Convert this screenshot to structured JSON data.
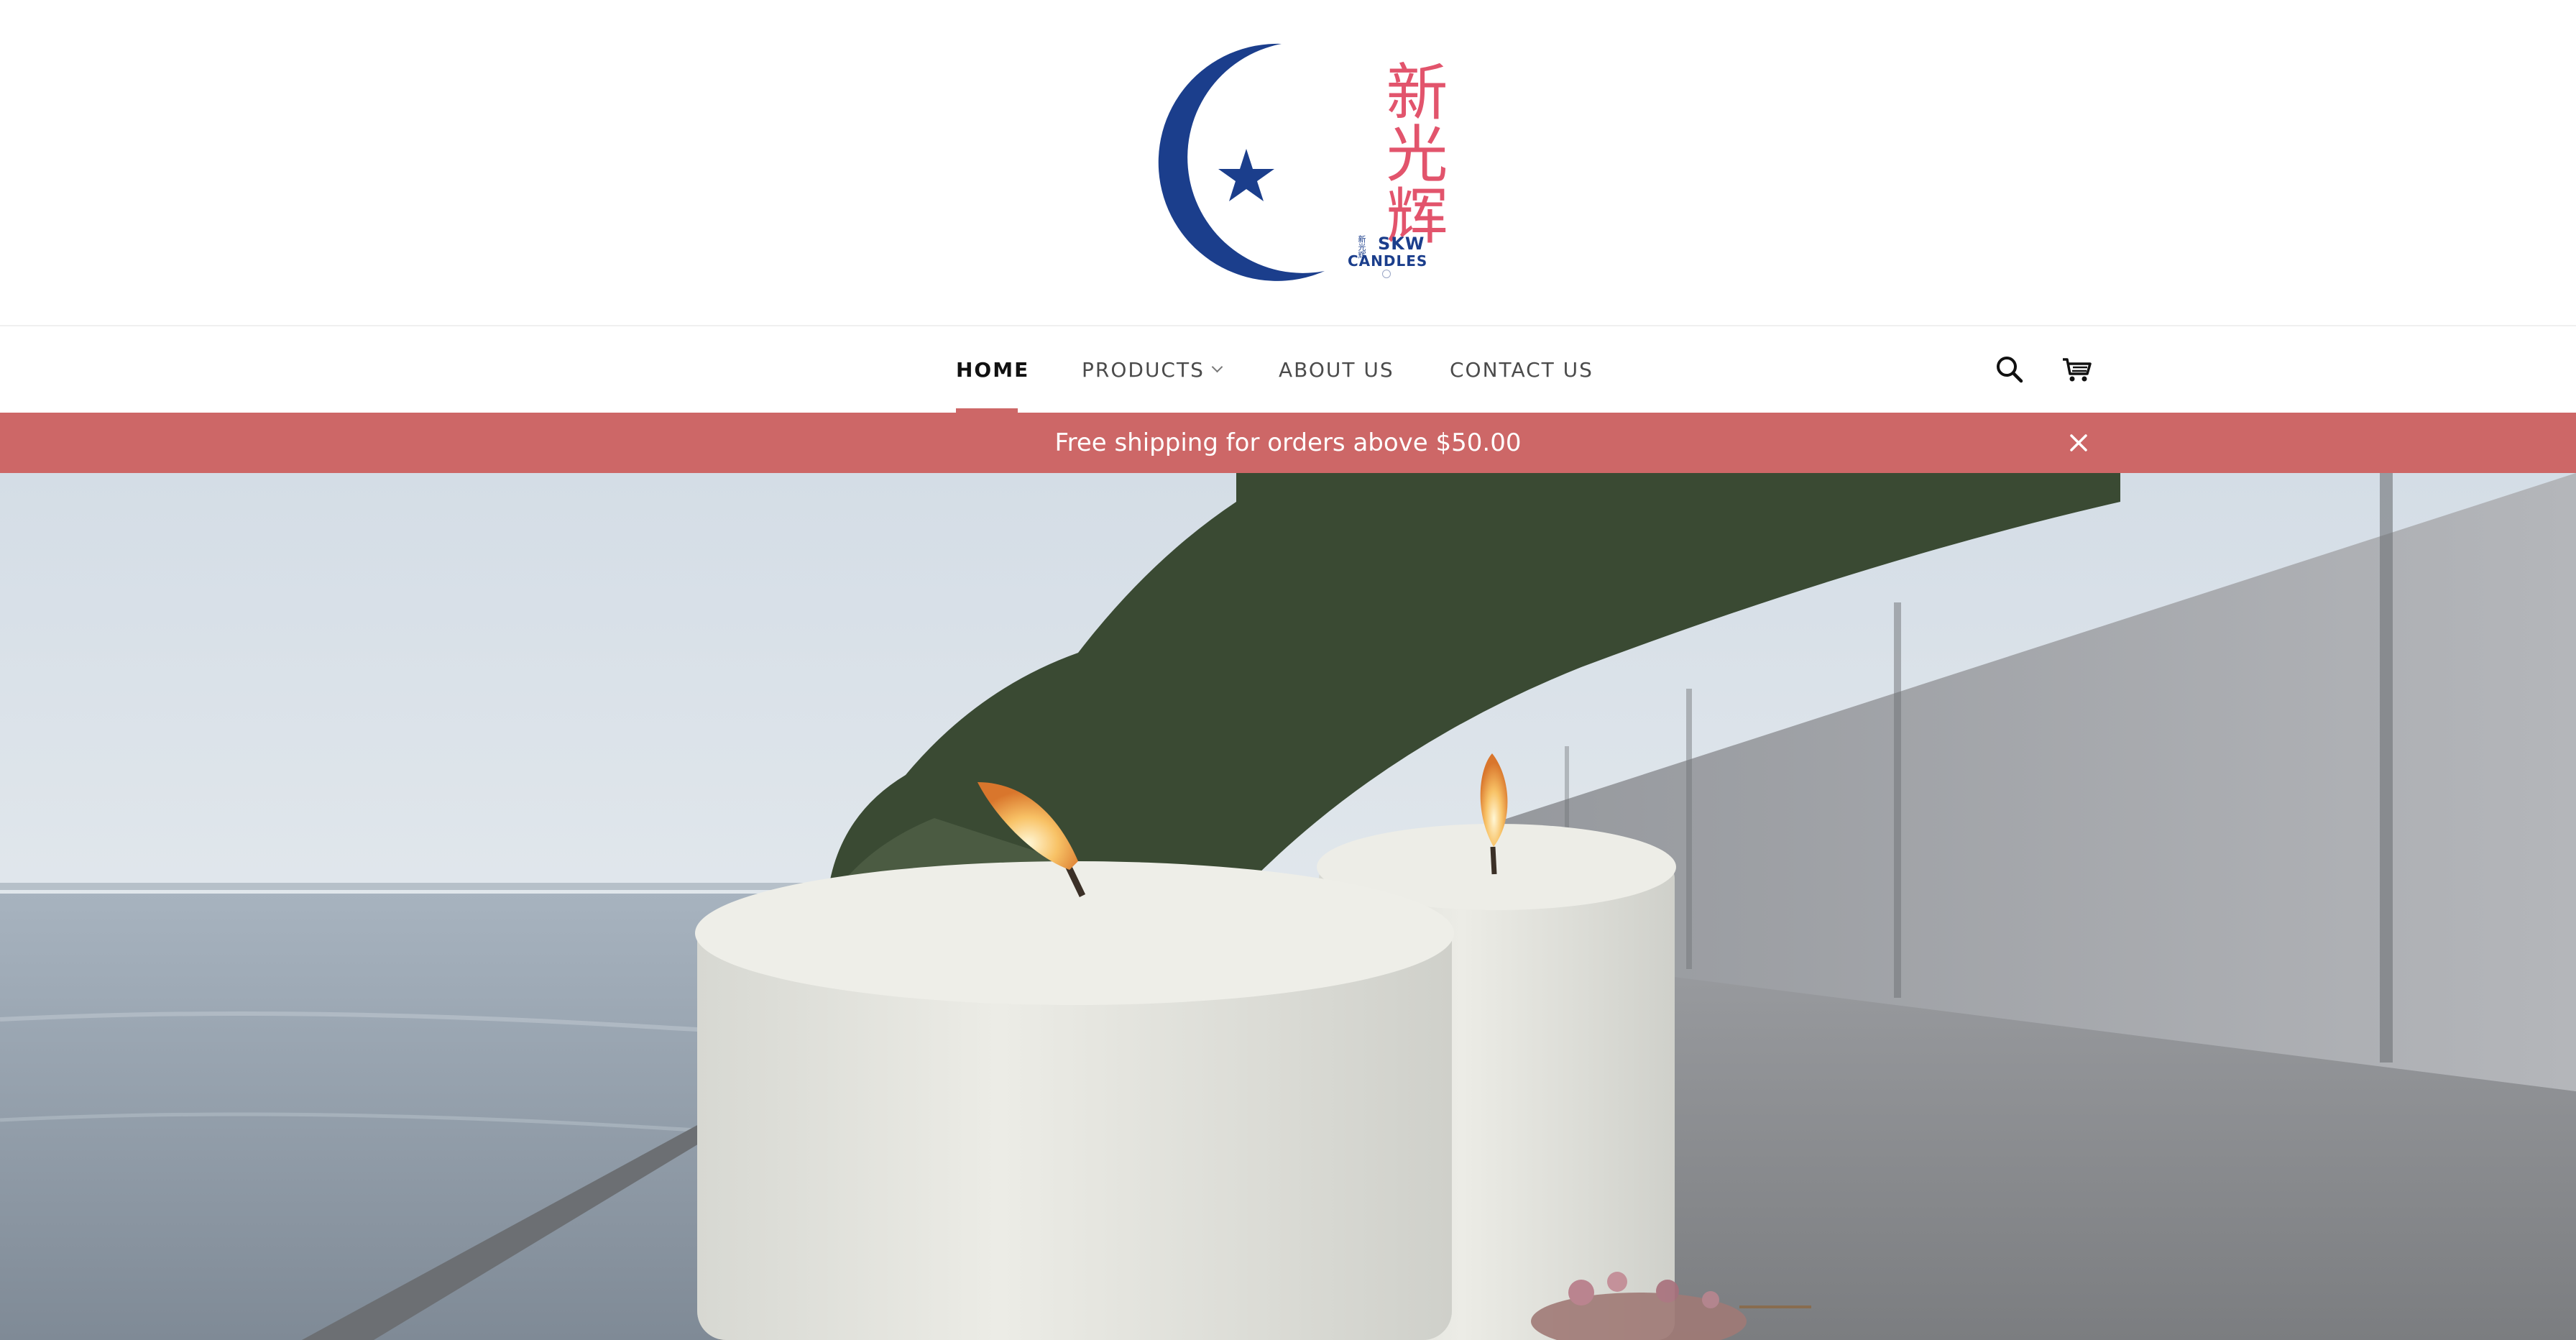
{
  "header": {
    "logo": {
      "cjk_text": "新光辉",
      "sub_text_small": "新光辉",
      "brand_line_1": "SKW",
      "brand_line_2": "CANDLES"
    }
  },
  "nav": {
    "items": [
      {
        "label": "HOME",
        "active": true
      },
      {
        "label": "PRODUCTS",
        "has_dropdown": true
      },
      {
        "label": "ABOUT US"
      },
      {
        "label": "CONTACT US"
      }
    ],
    "icons": [
      "search-icon",
      "cart-icon"
    ]
  },
  "announcement": {
    "text": "Free shipping for orders above $50.00",
    "close_icon": "close-icon"
  },
  "colors": {
    "accent": "#cd6767",
    "logo_blue": "#1b3e8c",
    "logo_pink": "#e2546c",
    "text": "#4b4b4b"
  },
  "hero": {
    "image": "two-white-pillar-candles-by-the-sea"
  }
}
